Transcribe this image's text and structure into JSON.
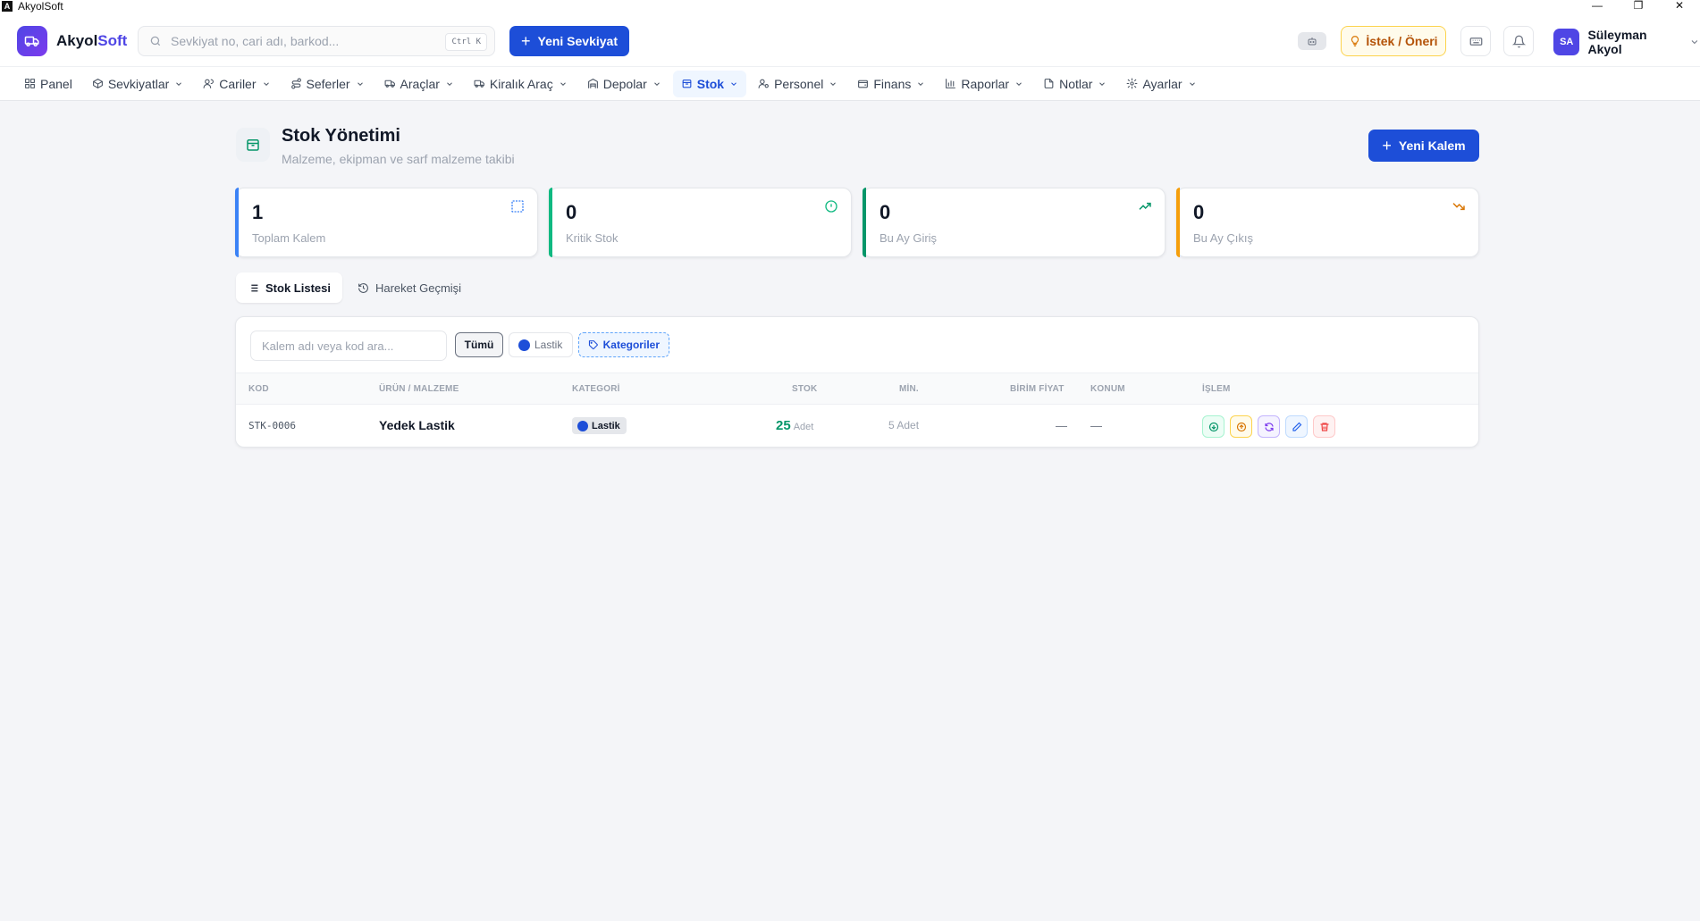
{
  "window": {
    "title": "AkyolSoft",
    "logo_letter": "A",
    "minimize": "—",
    "maximize": "❐",
    "close": "✕"
  },
  "header": {
    "brand_part1": "Akyol",
    "brand_part2": "Soft",
    "search_placeholder": "Sevkiyat no, cari adı, barkod...",
    "search_value": "",
    "search_shortcut": "Ctrl K",
    "new_shipment_label": "Yeni Sevkiyat",
    "suggest_label": "İstek / Öneri",
    "user_initials": "SA",
    "user_name": "Süleyman Akyol"
  },
  "nav": {
    "items": [
      {
        "label": "Panel",
        "icon": "grid-icon",
        "has_menu": false
      },
      {
        "label": "Sevkiyatlar",
        "icon": "box-icon",
        "has_menu": true
      },
      {
        "label": "Cariler",
        "icon": "users-icon",
        "has_menu": true
      },
      {
        "label": "Seferler",
        "icon": "route-icon",
        "has_menu": true
      },
      {
        "label": "Araçlar",
        "icon": "truck-icon",
        "has_menu": true
      },
      {
        "label": "Kiralık Araç",
        "icon": "truck-icon",
        "has_menu": true
      },
      {
        "label": "Depolar",
        "icon": "warehouse-icon",
        "has_menu": true
      },
      {
        "label": "Stok",
        "icon": "package-icon",
        "has_menu": true,
        "active": true
      },
      {
        "label": "Personel",
        "icon": "user-cog-icon",
        "has_menu": true
      },
      {
        "label": "Finans",
        "icon": "wallet-icon",
        "has_menu": true
      },
      {
        "label": "Raporlar",
        "icon": "bar-chart-icon",
        "has_menu": true
      },
      {
        "label": "Notlar",
        "icon": "file-icon",
        "has_menu": true
      },
      {
        "label": "Ayarlar",
        "icon": "gear-icon",
        "has_menu": true
      }
    ]
  },
  "page": {
    "title": "Stok Yönetimi",
    "subtitle": "Malzeme, ekipman ve sarf malzeme takibi",
    "new_item_label": "Yeni Kalem"
  },
  "stats": [
    {
      "value": "1",
      "label": "Toplam Kalem",
      "icon": "dashed-box-icon",
      "color": "#3b82f6"
    },
    {
      "value": "0",
      "label": "Kritik Stok",
      "icon": "alert-circle-icon",
      "color": "#10b981"
    },
    {
      "value": "0",
      "label": "Bu Ay Giriş",
      "icon": "trending-up-icon",
      "color": "#059669"
    },
    {
      "value": "0",
      "label": "Bu Ay Çıkış",
      "icon": "trending-down-icon",
      "color": "#d97706"
    }
  ],
  "tabs": {
    "list_label": "Stok Listesi",
    "history_label": "Hareket Geçmişi"
  },
  "filters": {
    "search_placeholder": "Kalem adı veya kod ara...",
    "search_value": "",
    "all_label": "Tümü",
    "tire_label": "Lastik",
    "categories_label": "Kategoriler"
  },
  "table": {
    "headers": {
      "code": "KOD",
      "product": "ÜRÜN / MALZEME",
      "category": "KATEGORİ",
      "stock": "STOK",
      "min": "MİN.",
      "unit_price": "BİRİM FİYAT",
      "location": "KONUM",
      "action": "İŞLEM"
    },
    "rows": [
      {
        "code": "STK-0006",
        "product": "Yedek Lastik",
        "category": "Lastik",
        "stock": "25",
        "stock_unit": "Adet",
        "min": "5 Adet",
        "unit_price": "—",
        "location": "—"
      }
    ]
  },
  "colors": {
    "primary": "#1d4ed8",
    "brand": "#4f46e5",
    "success": "#059669",
    "warning": "#d97706",
    "danger": "#ef4444"
  }
}
